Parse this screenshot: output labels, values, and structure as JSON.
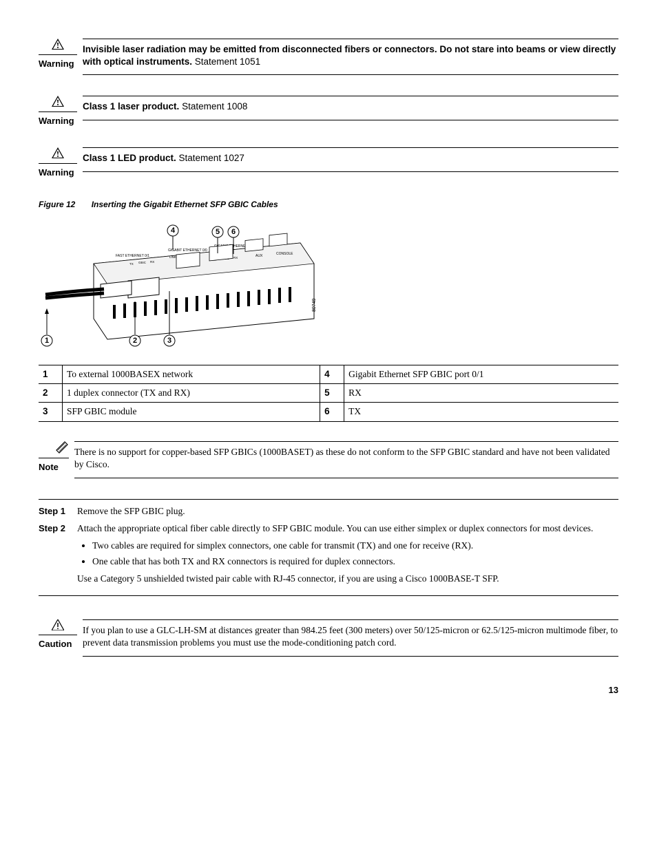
{
  "warnings": [
    {
      "label": "Warning",
      "bold": "Invisible laser radiation may be emitted from disconnected fibers or connectors. Do not stare into beams or view directly with optical instruments.",
      "plain": " Statement 1051"
    },
    {
      "label": "Warning",
      "bold": "Class 1 laser product.",
      "plain": " Statement 1008"
    },
    {
      "label": "Warning",
      "bold": "Class 1 LED product.",
      "plain": " Statement 1027"
    }
  ],
  "figure": {
    "label": "Figure 12",
    "title": "Inserting the Gigabit Ethernet SFP GBIC Cables",
    "drawing_id": "80749",
    "labels_small": {
      "fe01": "FAST ETHERNET 0/1",
      "ge00": "GIGABIT ETHERNET 0/0",
      "ge01": "GIGABIT ETHERNET 0/1",
      "aux": "AUX",
      "console": "CONSOLE",
      "link": "LINK",
      "tx": "TX",
      "gbic": "GBIC",
      "rx": "RX"
    }
  },
  "callouts": [
    {
      "n": "1",
      "desc": "To external 1000BASEX network",
      "n2": "4",
      "desc2": "Gigabit Ethernet SFP GBIC port 0/1"
    },
    {
      "n": "2",
      "desc": "1 duplex connector (TX and RX)",
      "n2": "5",
      "desc2": "RX"
    },
    {
      "n": "3",
      "desc": "SFP GBIC module",
      "n2": "6",
      "desc2": "TX"
    }
  ],
  "note": {
    "label": "Note",
    "text": "There is no support for copper-based SFP GBICs (1000BASET) as these do not conform to the SFP GBIC standard and have not been validated by Cisco."
  },
  "steps": {
    "step1": {
      "label": "Step 1",
      "text": "Remove the SFP GBIC plug."
    },
    "step2": {
      "label": "Step 2",
      "intro": "Attach the appropriate optical fiber cable directly to SFP GBIC module. You can use either simplex or duplex connectors for most devices.",
      "bullet1": "Two cables are required for simplex connectors, one cable for transmit (TX) and one for receive (RX).",
      "bullet2": "One cable that has both TX and RX connectors is required for duplex connectors.",
      "after": "Use a Category 5 unshielded twisted pair cable with RJ-45 connector, if you are using a Cisco 1000BASE-T SFP."
    }
  },
  "caution": {
    "label": "Caution",
    "text": "If you plan to use a GLC-LH-SM at distances greater than 984.25 feet (300 meters) over 50/125-micron or 62.5/125-micron multimode fiber, to prevent data transmission problems you must use the mode-conditioning patch cord."
  },
  "page_number": "13"
}
